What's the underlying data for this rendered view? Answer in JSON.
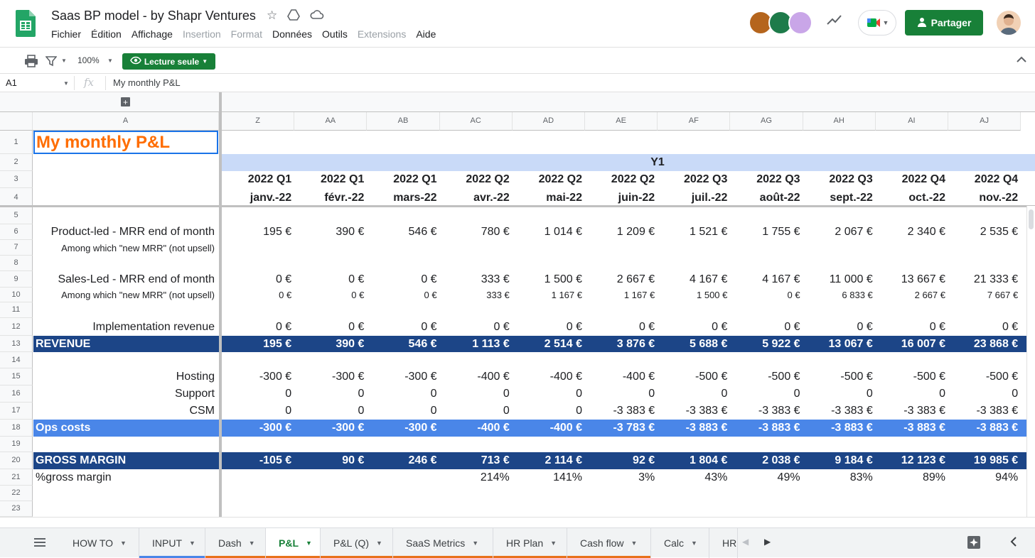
{
  "app": {
    "title": "Saas BP model - by Shapr Ventures",
    "menu": [
      "Fichier",
      "Édition",
      "Affichage",
      "Insertion",
      "Format",
      "Données",
      "Outils",
      "Extensions",
      "Aide"
    ],
    "menu_disabled": [
      false,
      false,
      false,
      true,
      true,
      false,
      false,
      true,
      false
    ],
    "share_label": "Partager",
    "brand_color": "#188038"
  },
  "toolbar": {
    "zoom": "100%",
    "mode_label": "Lecture seule"
  },
  "formula": {
    "cell_ref": "A1",
    "fx": "fx",
    "content": "My monthly P&L"
  },
  "sheet": {
    "col_a_header": "A",
    "columns": [
      "Z",
      "AA",
      "AB",
      "AC",
      "AD",
      "AE",
      "AF",
      "AG",
      "AH",
      "AI",
      "AJ"
    ],
    "row_numbers": [
      "1",
      "2",
      "3",
      "4",
      "5",
      "6",
      "7",
      "8",
      "9",
      "10",
      "11",
      "12",
      "13",
      "14",
      "15",
      "16",
      "17",
      "18",
      "19",
      "20",
      "21",
      "22",
      "23"
    ],
    "title": "My monthly P&L",
    "year_label": "Y1",
    "quarters": [
      "2022 Q1",
      "2022 Q1",
      "2022 Q1",
      "2022 Q2",
      "2022 Q2",
      "2022 Q2",
      "2022 Q3",
      "2022 Q3",
      "2022 Q3",
      "2022 Q4",
      "2022 Q4"
    ],
    "months": [
      "janv.-22",
      "févr.-22",
      "mars-22",
      "avr.-22",
      "mai-22",
      "juin-22",
      "juil.-22",
      "août-22",
      "sept.-22",
      "oct.-22",
      "nov.-22"
    ],
    "rows": [
      {
        "row": 6,
        "label": "Product-led - MRR end of month",
        "style": "normal",
        "values": [
          "195 €",
          "390 €",
          "546 €",
          "780 €",
          "1 014 €",
          "1 209 €",
          "1 521 €",
          "1 755 €",
          "2 067 €",
          "2 340 €",
          "2 535 €"
        ]
      },
      {
        "row": 7,
        "label": "Among which \"new MRR\" (not upsell)",
        "style": "small",
        "values": [
          "",
          "",
          "",
          "",
          "",
          "",
          "",
          "",
          "",
          "",
          ""
        ]
      },
      {
        "row": 9,
        "label": "Sales-Led - MRR end of month",
        "style": "normal",
        "values": [
          "0 €",
          "0 €",
          "0 €",
          "333 €",
          "1 500 €",
          "2 667 €",
          "4 167 €",
          "4 167 €",
          "11 000 €",
          "13 667 €",
          "21 333 €"
        ]
      },
      {
        "row": 10,
        "label": "Among which \"new MRR\" (not upsell)",
        "style": "small",
        "values": [
          "0 €",
          "0 €",
          "0 €",
          "333 €",
          "1 167 €",
          "1 167 €",
          "1 500 €",
          "0 €",
          "6 833 €",
          "2 667 €",
          "7 667 €"
        ]
      },
      {
        "row": 12,
        "label": "Implementation revenue",
        "style": "normal",
        "values": [
          "0 €",
          "0 €",
          "0 €",
          "0 €",
          "0 €",
          "0 €",
          "0 €",
          "0 €",
          "0 €",
          "0 €",
          "0 €"
        ]
      },
      {
        "row": 13,
        "label": "REVENUE",
        "style": "dark",
        "values": [
          "195 €",
          "390 €",
          "546 €",
          "1 113 €",
          "2 514 €",
          "3 876 €",
          "5 688 €",
          "5 922 €",
          "13 067 €",
          "16 007 €",
          "23 868 €"
        ]
      },
      {
        "row": 15,
        "label": "Hosting",
        "style": "normal",
        "values": [
          "-300 €",
          "-300 €",
          "-300 €",
          "-400 €",
          "-400 €",
          "-400 €",
          "-500 €",
          "-500 €",
          "-500 €",
          "-500 €",
          "-500 €"
        ]
      },
      {
        "row": 16,
        "label": "Support",
        "style": "normal",
        "values": [
          "0",
          "0",
          "0",
          "0",
          "0",
          "0",
          "0",
          "0",
          "0",
          "0",
          "0"
        ]
      },
      {
        "row": 17,
        "label": "CSM",
        "style": "normal",
        "values": [
          "0",
          "0",
          "0",
          "0",
          "0",
          "-3 383 €",
          "-3 383 €",
          "-3 383 €",
          "-3 383 €",
          "-3 383 €",
          "-3 383 €"
        ]
      },
      {
        "row": 18,
        "label": "Ops costs",
        "style": "blue",
        "values": [
          "-300 €",
          "-300 €",
          "-300 €",
          "-400 €",
          "-400 €",
          "-3 783 €",
          "-3 883 €",
          "-3 883 €",
          "-3 883 €",
          "-3 883 €",
          "-3 883 €"
        ]
      },
      {
        "row": 20,
        "label": "GROSS MARGIN",
        "style": "dark",
        "values": [
          "-105 €",
          "90 €",
          "246 €",
          "713 €",
          "2 114 €",
          "92 €",
          "1 804 €",
          "2 038 €",
          "9 184 €",
          "12 123 €",
          "19 985 €"
        ]
      },
      {
        "row": 21,
        "label": "%gross margin",
        "style": "pct",
        "values": [
          "",
          "",
          "",
          "214%",
          "141%",
          "3%",
          "43%",
          "49%",
          "83%",
          "89%",
          "94%"
        ]
      }
    ],
    "colors": {
      "dark": "#1c4587",
      "blue": "#4a86e8",
      "year_band": "#c9daf8",
      "title": "#ff6d01"
    }
  },
  "tabs": [
    {
      "label": "HOW TO",
      "color": ""
    },
    {
      "label": "INPUT",
      "color": "#4a86e8"
    },
    {
      "label": "Dash",
      "color": "#e8711c"
    },
    {
      "label": "P&L",
      "color": "#e8711c",
      "active": true
    },
    {
      "label": "P&L (Q)",
      "color": "#e8711c"
    },
    {
      "label": "SaaS Metrics",
      "color": "#e8711c"
    },
    {
      "label": "HR Plan",
      "color": "#e8711c"
    },
    {
      "label": "Cash flow",
      "color": "#e8711c"
    },
    {
      "label": "Calc",
      "color": ""
    },
    {
      "label": "HR",
      "color": ""
    }
  ]
}
